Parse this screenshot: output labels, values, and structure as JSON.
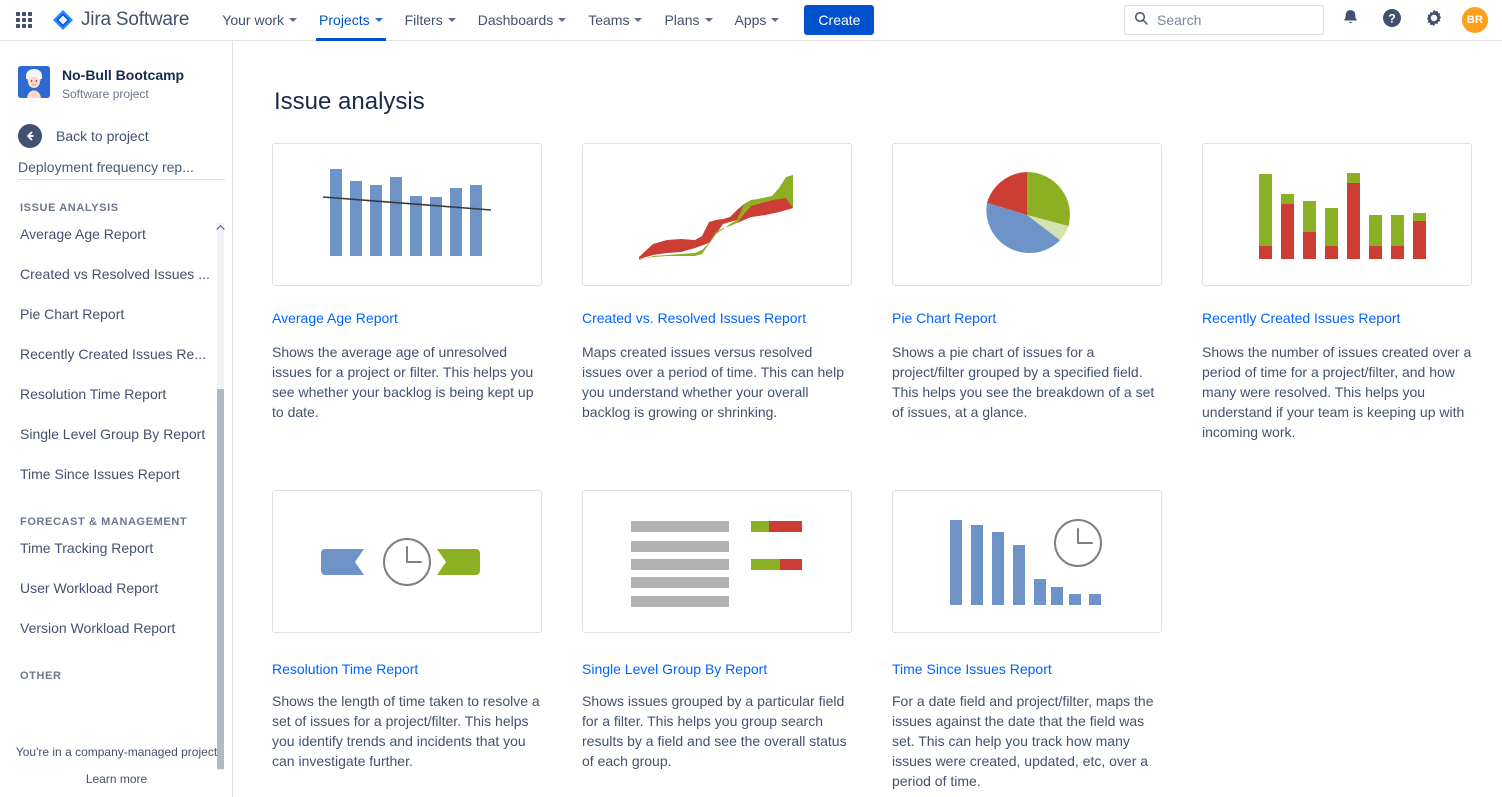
{
  "topnav": {
    "apps_icon": "apps-grid-icon",
    "brand": "Jira Software",
    "items": [
      {
        "label": "Your work",
        "active": false
      },
      {
        "label": "Projects",
        "active": true
      },
      {
        "label": "Filters",
        "active": false
      },
      {
        "label": "Dashboards",
        "active": false
      },
      {
        "label": "Teams",
        "active": false
      },
      {
        "label": "Plans",
        "active": false
      },
      {
        "label": "Apps",
        "active": false
      }
    ],
    "create_label": "Create",
    "search": {
      "placeholder": "Search",
      "value": ""
    },
    "icons": [
      "notifications-bell-icon",
      "help-icon",
      "settings-gear-icon"
    ],
    "avatar_initials": "BR"
  },
  "sidebar": {
    "project_name": "No-Bull Bootcamp",
    "project_type": "Software project",
    "back_label": "Back to project",
    "cut_off_item": "Deployment frequency rep...",
    "sections": [
      {
        "title": "ISSUE ANALYSIS",
        "items": [
          "Average Age Report",
          "Created vs Resolved Issues ...",
          "Pie Chart Report",
          "Recently Created Issues Re...",
          "Resolution Time Report",
          "Single Level Group By Report",
          "Time Since Issues Report"
        ]
      },
      {
        "title": "FORECAST & MANAGEMENT",
        "items": [
          "Time Tracking Report",
          "User Workload Report",
          "Version Workload Report"
        ]
      },
      {
        "title": "OTHER",
        "items": []
      }
    ],
    "footer_note": "You're in a company-managed project",
    "footer_link": "Learn more"
  },
  "main": {
    "page_title": "Issue analysis",
    "cards": [
      {
        "title": "Average Age Report",
        "description": "Shows the average age of unresolved issues for a project or filter. This helps you see whether your backlog is being kept up to date.",
        "thumb": "bar-chart-with-trendline-thumbnail"
      },
      {
        "title": "Created vs. Resolved Issues Report",
        "description": "Maps created issues versus resolved issues over a period of time. This can help you understand whether your overall backlog is growing or shrinking.",
        "thumb": "area-chart-thumbnail"
      },
      {
        "title": "Pie Chart Report",
        "description": "Shows a pie chart of issues for a project/filter grouped by a specified field. This helps you see the breakdown of a set of issues, at a glance.",
        "thumb": "pie-chart-thumbnail"
      },
      {
        "title": "Recently Created Issues Report",
        "description": "Shows the number of issues created over a period of time for a project/filter, and how many were resolved. This helps you understand if your team is keeping up with incoming work.",
        "thumb": "stacked-bar-chart-thumbnail"
      },
      {
        "title": "Resolution Time Report",
        "description": "Shows the length of time taken to resolve a set of issues for a project/filter. This helps you identify trends and incidents that you can investigate further.",
        "thumb": "arrows-and-clock-thumbnail"
      },
      {
        "title": "Single Level Group By Report",
        "description": "Shows issues grouped by a particular field for a filter. This helps you group search results by a field and see the overall status of each group.",
        "thumb": "grouped-list-thumbnail"
      },
      {
        "title": "Time Since Issues Report",
        "description": "For a date field and project/filter, maps the issues against the date that the field was set. This can help you track how many issues were created, updated, etc, over a period of time.",
        "thumb": "descending-bars-with-clock-thumbnail"
      }
    ]
  },
  "chart_data": [
    {
      "type": "bar",
      "name": "average-age-report-thumbnail",
      "title": "Average Age Report",
      "categories": [
        "1",
        "2",
        "3",
        "4",
        "5",
        "6",
        "7",
        "8"
      ],
      "values": [
        100,
        87,
        82,
        90,
        68,
        67,
        78,
        81
      ],
      "series": [
        {
          "name": "average age",
          "values": [
            100,
            87,
            82,
            90,
            68,
            67,
            78,
            81
          ]
        }
      ],
      "trendline": [
        82,
        62
      ],
      "colors": {
        "bar": "#6d93c8",
        "trendline": "#3b3b3b"
      },
      "grid": false,
      "legend": "none",
      "ylim": [
        0,
        110
      ]
    },
    {
      "type": "area",
      "name": "created-vs-resolved-thumbnail",
      "title": "Created vs. Resolved Issues Report",
      "x": [
        0,
        1,
        2,
        3,
        4,
        5,
        6,
        7,
        8,
        9
      ],
      "series": [
        {
          "name": "Created",
          "color": "#cc3d33",
          "values": [
            6,
            28,
            36,
            37,
            36,
            56,
            62,
            64,
            68,
            72
          ]
        },
        {
          "name": "Resolved",
          "color": "#8cb023",
          "values": [
            4,
            8,
            9,
            10,
            12,
            60,
            76,
            80,
            88,
            98
          ]
        }
      ],
      "grid": false,
      "legend": "none"
    },
    {
      "type": "pie",
      "name": "pie-chart-thumbnail",
      "title": "Pie Chart Report",
      "labels": [
        "Green slice",
        "Light green slice",
        "Blue slice",
        "Red slice"
      ],
      "values": [
        29,
        7,
        34,
        30
      ],
      "colors": [
        "#8cb023",
        "#d6e3b0",
        "#6d93c8",
        "#cc3d33"
      ],
      "legend": "none"
    },
    {
      "type": "bar",
      "name": "recently-created-issues-thumbnail",
      "title": "Recently Created Issues Report",
      "categories": [
        "1",
        "2",
        "3",
        "4",
        "5",
        "6",
        "7",
        "8"
      ],
      "stacked": true,
      "series": [
        {
          "name": "Resolved",
          "color": "#cc3d33",
          "values": [
            18,
            62,
            30,
            17,
            88,
            17,
            17,
            44
          ]
        },
        {
          "name": "Created",
          "color": "#8cb023",
          "values": [
            81,
            14,
            37,
            45,
            13,
            35,
            35,
            9
          ]
        }
      ],
      "grid": false,
      "legend": "none",
      "ylim": [
        0,
        110
      ]
    },
    {
      "type": "bar",
      "name": "single-level-group-by-thumbnail",
      "title": "Single Level Group By Report",
      "categories": [
        "row 1",
        "row 2",
        "row 3",
        "row 4",
        "row 5"
      ],
      "stacked": true,
      "series": [
        {
          "name": "group label",
          "color": "#b2b2b2",
          "values": [
            100,
            100,
            100,
            100,
            100
          ]
        },
        {
          "name": "done",
          "color": "#8cb023",
          "values": [
            31,
            0,
            56,
            0,
            0
          ]
        },
        {
          "name": "not done",
          "color": "#cc3d33",
          "values": [
            69,
            0,
            44,
            0,
            0
          ]
        }
      ],
      "grid": false,
      "legend": "none"
    },
    {
      "type": "bar",
      "name": "time-since-issues-thumbnail",
      "title": "Time Since Issues Report",
      "categories": [
        "1",
        "2",
        "3",
        "4",
        "5",
        "6",
        "7",
        "8"
      ],
      "values": [
        100,
        94,
        86,
        70,
        31,
        22,
        12,
        12
      ],
      "series": [
        {
          "name": "issues",
          "values": [
            100,
            94,
            86,
            70,
            31,
            22,
            12,
            12
          ]
        }
      ],
      "colors": {
        "bar": "#6d93c8"
      },
      "grid": false,
      "legend": "none",
      "ylim": [
        0,
        110
      ]
    }
  ]
}
